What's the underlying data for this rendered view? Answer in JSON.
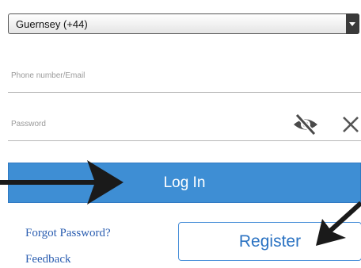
{
  "country_select": {
    "value": "Guernsey (+44)"
  },
  "phone_field": {
    "placeholder": "Phone number/Email"
  },
  "password_field": {
    "placeholder": "Password"
  },
  "buttons": {
    "login": "Log In",
    "register": "Register"
  },
  "links": {
    "forgot_password": "Forgot Password?",
    "feedback": "Feedback"
  },
  "icons": {
    "toggle_visibility": "eye-slash-icon",
    "clear": "close-icon",
    "select_caret": "caret-down-icon",
    "annotations": "arrow-icon"
  },
  "colors": {
    "primary": "#3e8ed4",
    "link": "#2a5db0",
    "register_text": "#2a72c2",
    "annotation_arrow": "#1a1a1a"
  }
}
